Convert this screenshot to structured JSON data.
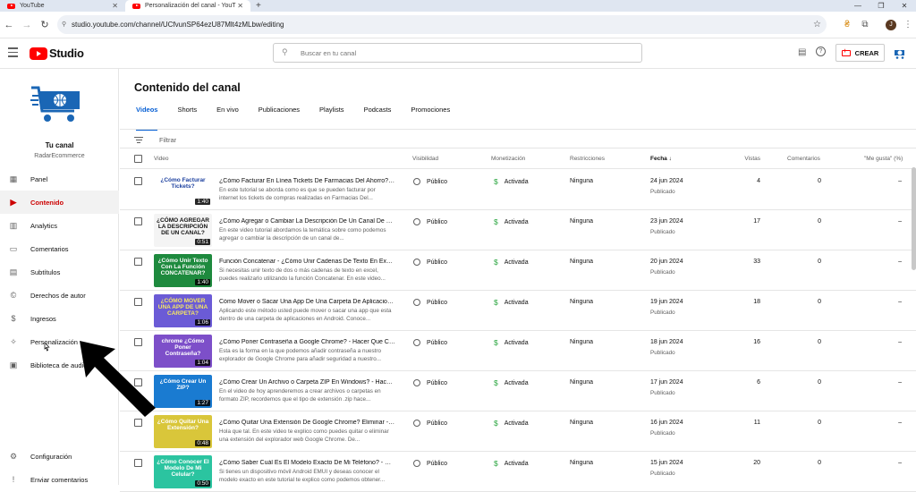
{
  "browser": {
    "tabs": [
      {
        "title": "YouTube",
        "active": false
      },
      {
        "title": "Personalización del canal - YouT",
        "active": true
      }
    ],
    "url": "studio.youtube.com/channel/UCfvunSP64ezU87Mlt4zMLbw/editing",
    "profile_initial": "J"
  },
  "header": {
    "logo_text": "Studio",
    "search_placeholder": "Buscar en tu canal",
    "create_label": "CREAR"
  },
  "sidebar": {
    "channel_label": "Tu canal",
    "channel_name": "RadarEcommerce",
    "items": [
      {
        "label": "Panel",
        "icon": "dashboard-icon",
        "active": false
      },
      {
        "label": "Contenido",
        "icon": "content-icon",
        "active": true
      },
      {
        "label": "Analytics",
        "icon": "analytics-icon",
        "active": false
      },
      {
        "label": "Comentarios",
        "icon": "comments-icon",
        "active": false
      },
      {
        "label": "Subtítulos",
        "icon": "subtitles-icon",
        "active": false
      },
      {
        "label": "Derechos de autor",
        "icon": "copyright-icon",
        "active": false
      },
      {
        "label": "Ingresos",
        "icon": "earn-icon",
        "active": false
      },
      {
        "label": "Personalización",
        "icon": "customization-icon",
        "active": false
      },
      {
        "label": "Biblioteca de audio",
        "icon": "audio-library-icon",
        "active": false
      }
    ],
    "bottom_items": [
      {
        "label": "Configuración",
        "icon": "settings-icon"
      },
      {
        "label": "Enviar comentarios",
        "icon": "feedback-icon"
      }
    ]
  },
  "main": {
    "title": "Contenido del canal",
    "tabs": [
      "Videos",
      "Shorts",
      "En vivo",
      "Publicaciones",
      "Playlists",
      "Podcasts",
      "Promociones"
    ],
    "filter_placeholder": "Filtrar",
    "columns": {
      "video": "Video",
      "visibility": "Visibilidad",
      "monetization": "Monetización",
      "restrictions": "Restricciones",
      "date": "Fecha",
      "views": "Vistas",
      "comments": "Comentarios",
      "likes": "\"Me gusta\" (%)"
    },
    "rows": [
      {
        "title": "¿Cómo Facturar En Línea Tickets De Farmacias Del Ahorro? - ...",
        "desc": "En este tutorial se aborda como es que se pueden facturar por internet los tickets de compras realizadas en Farmacias Del...",
        "duration": "1:40",
        "thumb_text": "¿Cómo Facturar Tickets?",
        "thumb_bg": "#ffffff",
        "thumb_color": "#1b3f9e",
        "visibility": "Público",
        "monetization": "Activada",
        "restrictions": "Ninguna",
        "date": "24 jun 2024",
        "status": "Publicado",
        "views": "4",
        "comments": "0",
        "likes": "–"
      },
      {
        "title": "¿Cómo Agregar o Cambiar La Descripción De Un Canal De Yo...",
        "desc": "En este video tutorial abordamos la temática sobre como podemos agregar o cambiar la descripción de un canal de...",
        "duration": "0:51",
        "thumb_text": "¿CÓMO AGREGAR LA DESCRIPCIÓN DE UN CANAL?",
        "thumb_bg": "#f4f4f4",
        "thumb_color": "#111111",
        "visibility": "Público",
        "monetization": "Activada",
        "restrictions": "Ninguna",
        "date": "23 jun 2024",
        "status": "Publicado",
        "views": "17",
        "comments": "0",
        "likes": "–"
      },
      {
        "title": "Función Concatenar - ¿Cómo Unir Cadenas De Texto En Excel...",
        "desc": "Si necesitas unir texto de dos o más cadenas de texto en excel, puedes realizarlo utilizando la función Concatenar. En este video...",
        "duration": "1:40",
        "thumb_text": "¿Cómo Unir Texto Con La Función CONCATENAR?",
        "thumb_bg": "#1e8a3e",
        "thumb_color": "#ffffff",
        "visibility": "Público",
        "monetization": "Activada",
        "restrictions": "Ninguna",
        "date": "20 jun 2024",
        "status": "Publicado",
        "views": "33",
        "comments": "0",
        "likes": "–"
      },
      {
        "title": "Cómo Mover o Sacar Una App De Una Carpeta De Aplicacion...",
        "desc": "Aplicando este método usted puede mover o sacar una app que esta dentro de una carpeta de aplicaciones en Android. Conoce...",
        "duration": "1:06",
        "thumb_text": "¿CÓMO MOVER UNA APP DE UNA CARPETA?",
        "thumb_bg": "#6b5bd6",
        "thumb_color": "#f5e663",
        "visibility": "Público",
        "monetization": "Activada",
        "restrictions": "Ninguna",
        "date": "19 jun 2024",
        "status": "Publicado",
        "views": "18",
        "comments": "0",
        "likes": "–"
      },
      {
        "title": "¿Cómo Poner Contraseña a Google Chrome? - Hacer Que Chr...",
        "desc": "Esta es la forma en la que podemos añadir contraseña a nuestro explorador de Google Chrome para añadir seguridad a nuestro...",
        "duration": "1:04",
        "thumb_text": "chrome ¿Cómo Poner Contraseña?",
        "thumb_bg": "#7d4fc9",
        "thumb_color": "#ffffff",
        "visibility": "Público",
        "monetization": "Activada",
        "restrictions": "Ninguna",
        "date": "18 jun 2024",
        "status": "Publicado",
        "views": "16",
        "comments": "0",
        "likes": "–"
      },
      {
        "title": "¿Cómo Crear Un Archivo o Carpeta ZIP En Windows? - Hacer ...",
        "desc": "En el video de hoy aprenderemos a crear archivos o carpetas en formato ZIP, recordemos que el tipo de extensión .zip hace...",
        "duration": "1:27",
        "thumb_text": "¿Cómo Crear Un ZIP?",
        "thumb_bg": "#1a7bd1",
        "thumb_color": "#ffffff",
        "visibility": "Público",
        "monetization": "Activada",
        "restrictions": "Ninguna",
        "date": "17 jun 2024",
        "status": "Publicado",
        "views": "6",
        "comments": "0",
        "likes": "–"
      },
      {
        "title": "¿Cómo Quitar Una Extensión De Google Chrome? Eliminar - D...",
        "desc": "Hola que tal. En este video te explico como puedes quitar o eliminar una extensión del explorador web Google Chrome. De...",
        "duration": "0:48",
        "thumb_text": "¿Cómo Quitar Una Extensión?",
        "thumb_bg": "#d9c63a",
        "thumb_color": "#ffffff",
        "visibility": "Público",
        "monetization": "Activada",
        "restrictions": "Ninguna",
        "date": "16 jun 2024",
        "status": "Publicado",
        "views": "11",
        "comments": "0",
        "likes": "–"
      },
      {
        "title": "¿Cómo Saber Cuál Es El Modelo Exacto De Mi Teléfono? - Co...",
        "desc": "Si tienes un dispositivo móvil Android EMUI y deseas conocer el modelo exacto en este tutorial te explico como podemos obtener...",
        "duration": "0:50",
        "thumb_text": "¿Cómo Conocer El Modelo De Mi Celular?",
        "thumb_bg": "#2bc4a0",
        "thumb_color": "#ffffff",
        "visibility": "Público",
        "monetization": "Activada",
        "restrictions": "Ninguna",
        "date": "15 jun 2024",
        "status": "Publicado",
        "views": "20",
        "comments": "0",
        "likes": "–"
      }
    ]
  }
}
